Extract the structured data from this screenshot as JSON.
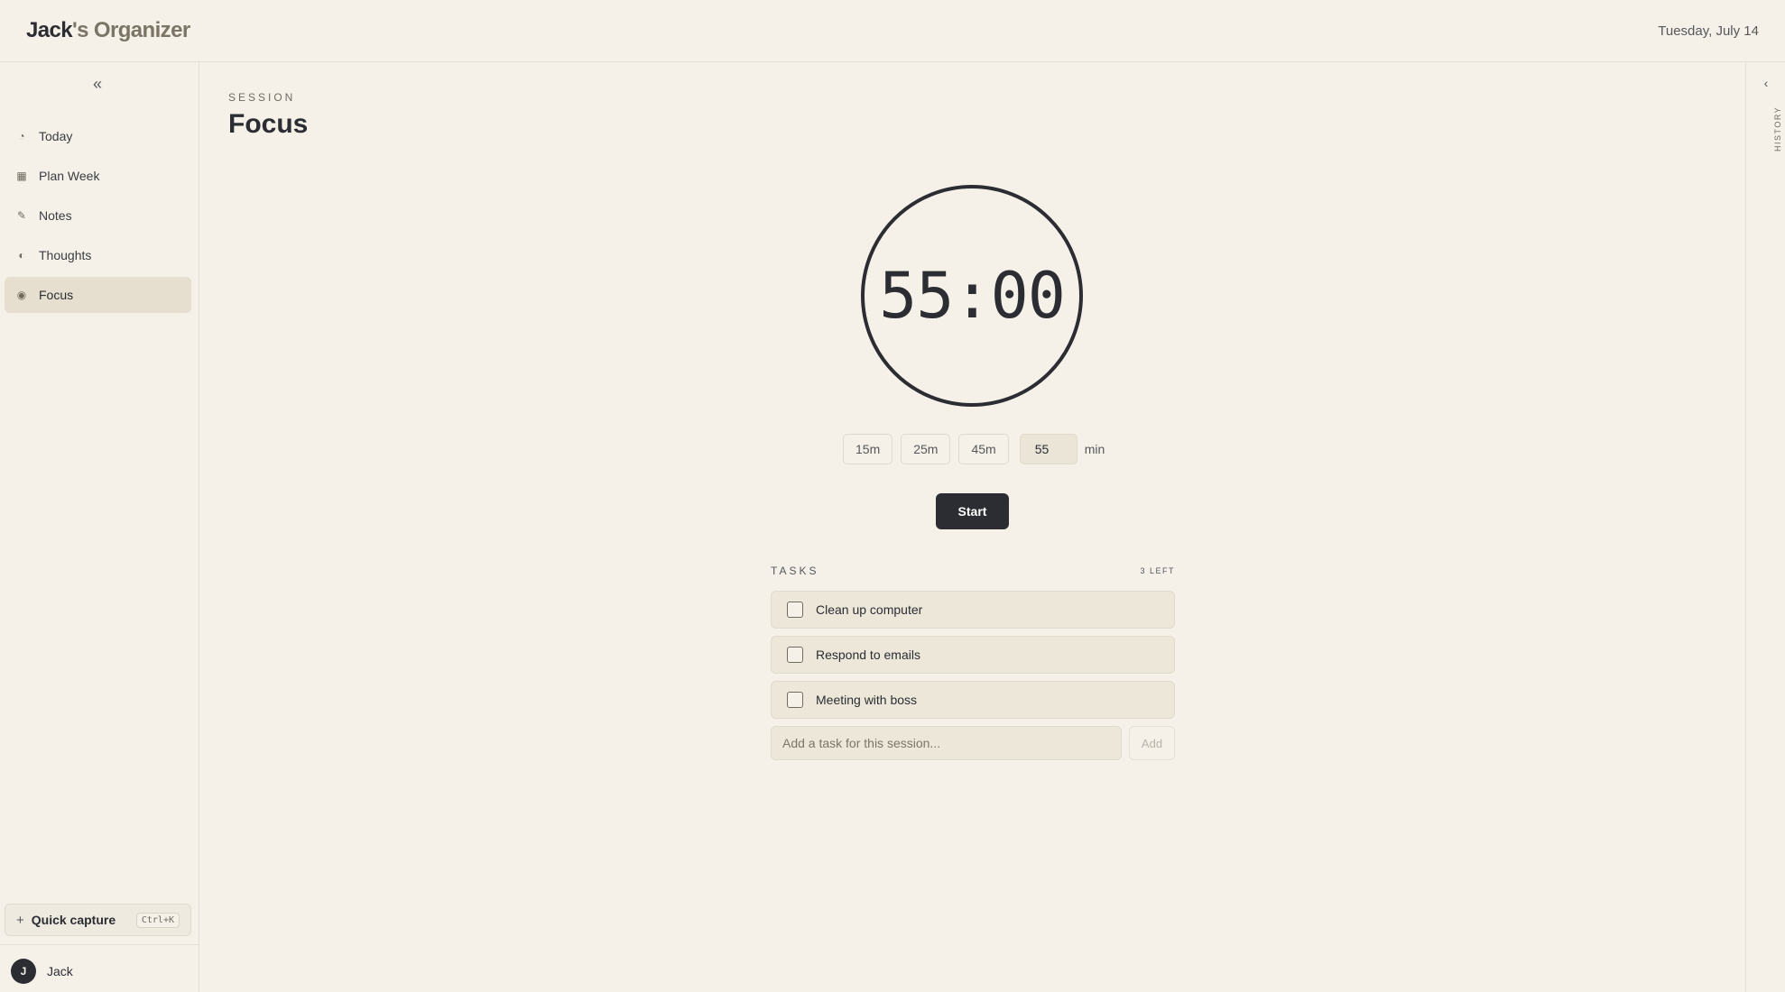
{
  "header": {
    "brand_first": "Jack",
    "brand_rest": "'s Organizer",
    "date": "Tuesday, July 14"
  },
  "sidebar": {
    "collapse_glyph": "«",
    "items": [
      {
        "label": "Today",
        "icon": "clock-icon",
        "glyph": "◔",
        "active": false
      },
      {
        "label": "Plan Week",
        "icon": "grid-icon",
        "glyph": "▦",
        "active": false
      },
      {
        "label": "Notes",
        "icon": "pencil-icon",
        "glyph": "✎",
        "active": false
      },
      {
        "label": "Thoughts",
        "icon": "half-moon-icon",
        "glyph": "◐",
        "active": false
      },
      {
        "label": "Focus",
        "icon": "target-icon",
        "glyph": "◉",
        "active": true
      }
    ],
    "quick_capture": {
      "plus": "+",
      "label": "Quick capture",
      "shortcut": "Ctrl+K"
    },
    "user": {
      "initial": "J",
      "name": "Jack"
    }
  },
  "main": {
    "section_label": "SESSION",
    "title": "Focus",
    "timer": "55:00",
    "presets": [
      "15m",
      "25m",
      "45m"
    ],
    "minutes_value": "55",
    "minutes_unit": "min",
    "start_label": "Start",
    "tasks": {
      "label": "TASKS",
      "count": "3 LEFT",
      "items": [
        {
          "label": "Clean up computer",
          "done": false
        },
        {
          "label": "Respond to emails",
          "done": false
        },
        {
          "label": "Meeting with boss",
          "done": false
        }
      ],
      "add_placeholder": "Add a task for this session...",
      "add_label": "Add"
    }
  },
  "history": {
    "toggle_glyph": "‹",
    "label": "HISTORY"
  },
  "colors": {
    "background": "#f5f1e8",
    "accent_dark": "#2b2d33",
    "active_nav": "#e6dfcf"
  }
}
